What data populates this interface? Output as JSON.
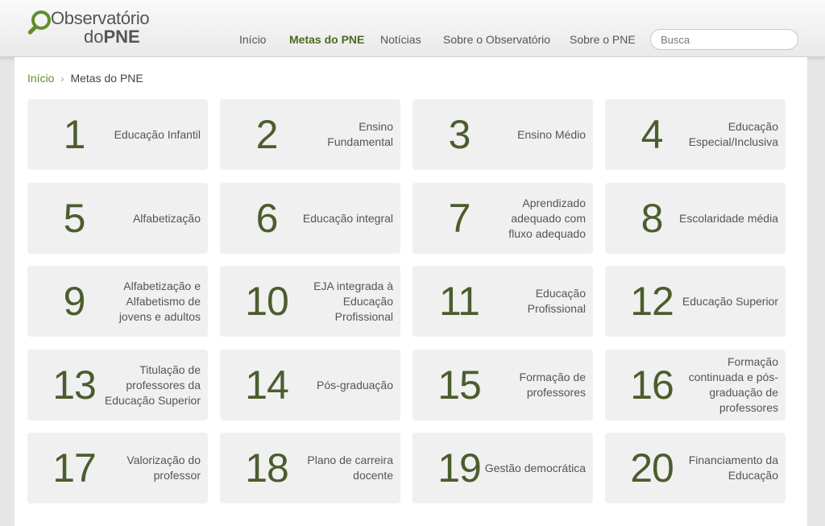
{
  "logo": {
    "line1": "Observatório",
    "line2_pre": "do",
    "line2_bold": "PNE"
  },
  "nav": [
    "Início",
    "Metas do PNE",
    "Notícias",
    "Sobre o Observatório",
    "Sobre o PNE"
  ],
  "nav_active_index": 1,
  "search": {
    "placeholder": "Busca",
    "value": ""
  },
  "breadcrumb": {
    "home": "Início",
    "separator": "›",
    "current": "Metas do PNE"
  },
  "goals": [
    {
      "number": "1",
      "label": "Educação Infantil"
    },
    {
      "number": "2",
      "label": "Ensino Fundamental"
    },
    {
      "number": "3",
      "label": "Ensino Médio"
    },
    {
      "number": "4",
      "label": "Educação Especial/Inclusiva"
    },
    {
      "number": "5",
      "label": "Alfabetização"
    },
    {
      "number": "6",
      "label": "Educação integral"
    },
    {
      "number": "7",
      "label": "Aprendizado adequado com fluxo adequado"
    },
    {
      "number": "8",
      "label": "Escolaridade média"
    },
    {
      "number": "9",
      "label": "Alfabetização e Alfabetismo de jovens e adultos"
    },
    {
      "number": "10",
      "label": "EJA integrada à Educação Profissional"
    },
    {
      "number": "11",
      "label": "Educação Profissional"
    },
    {
      "number": "12",
      "label": "Educação Superior"
    },
    {
      "number": "13",
      "label": "Titulação de professores da Educação Superior"
    },
    {
      "number": "14",
      "label": "Pós-graduação"
    },
    {
      "number": "15",
      "label": "Formação de professores"
    },
    {
      "number": "16",
      "label": "Formação continuada e pós-graduação de professores"
    },
    {
      "number": "17",
      "label": "Valorização do professor"
    },
    {
      "number": "18",
      "label": "Plano de carreira docente"
    },
    {
      "number": "19",
      "label": "Gestão democrática"
    },
    {
      "number": "20",
      "label": "Financiamento da Educação"
    }
  ],
  "colors": {
    "accent": "#5f8f2c",
    "number": "#4b5d2e",
    "card_bg": "#f0f0f0"
  }
}
